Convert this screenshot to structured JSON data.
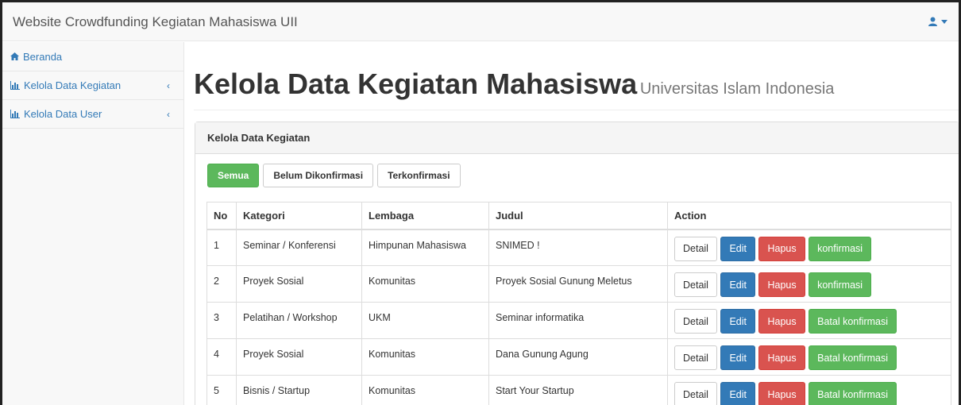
{
  "navbar": {
    "brand": "Website Crowdfunding Kegiatan Mahasiswa UII",
    "user_icon": "user-icon",
    "caret_icon": "caret-down-icon"
  },
  "sidebar": {
    "items": [
      {
        "label": "Beranda",
        "icon": "home-icon"
      },
      {
        "label": "Kelola Data Kegiatan",
        "icon": "bar-chart-icon"
      },
      {
        "label": "Kelola Data User",
        "icon": "bar-chart-icon"
      }
    ]
  },
  "header": {
    "title": "Kelola Data Kegiatan Mahasiswa",
    "subtitle": "Universitas Islam Indonesia"
  },
  "panel": {
    "heading": "Kelola Data Kegiatan",
    "filters": [
      "Semua",
      "Belum Dikonfirmasi",
      "Terkonfirmasi"
    ]
  },
  "table": {
    "columns": [
      "No",
      "Kategori",
      "Lembaga",
      "Judul",
      "Action"
    ],
    "rows": [
      {
        "no": "1",
        "kategori": "Seminar / Konferensi",
        "lembaga": "Himpunan Mahasiswa",
        "judul": "SNIMED !",
        "confirm": "konfirmasi"
      },
      {
        "no": "2",
        "kategori": "Proyek Sosial",
        "lembaga": "Komunitas",
        "judul": "Proyek Sosial Gunung Meletus",
        "confirm": "konfirmasi"
      },
      {
        "no": "3",
        "kategori": "Pelatihan / Workshop",
        "lembaga": "UKM",
        "judul": "Seminar informatika",
        "confirm": "Batal konfirmasi"
      },
      {
        "no": "4",
        "kategori": "Proyek Sosial",
        "lembaga": "Komunitas",
        "judul": "Dana Gunung Agung",
        "confirm": "Batal konfirmasi"
      },
      {
        "no": "5",
        "kategori": "Bisnis / Startup",
        "lembaga": "Komunitas",
        "judul": "Start Your Startup",
        "confirm": "Batal konfirmasi"
      }
    ],
    "action_labels": {
      "detail": "Detail",
      "edit": "Edit",
      "hapus": "Hapus"
    }
  },
  "colors": {
    "primary": "#337ab7",
    "success": "#5cb85c",
    "danger": "#d9534f"
  }
}
